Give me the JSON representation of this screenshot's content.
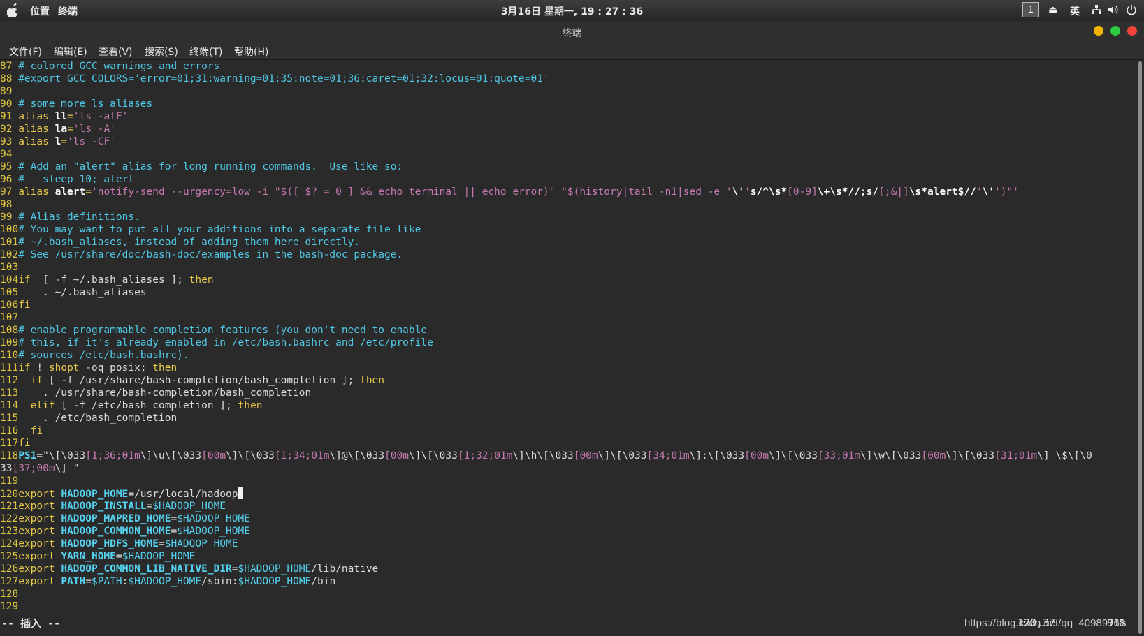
{
  "topbar": {
    "places": "位置",
    "app": "终端",
    "clock": "3月16日 星期一, 19 : 27 : 36",
    "workspace": "1",
    "input_method": "英"
  },
  "window": {
    "title": "终端"
  },
  "menu": [
    "文件(F)",
    "编辑(E)",
    "查看(V)",
    "搜索(S)",
    "终端(T)",
    "帮助(H)"
  ],
  "status": {
    "mode": "-- 插入 --",
    "position": "120,37",
    "percent": "91%"
  },
  "watermark": "https://blog.csdn.net/qq_40989768",
  "lines": [
    {
      "n": "87",
      "parts": [
        [
          "c",
          "# colored GCC warnings and errors"
        ]
      ]
    },
    {
      "n": "88",
      "parts": [
        [
          "c",
          "#export GCC_COLORS='error=01;31:warning=01;35:note=01;36:caret=01;32:locus=01:quote=01'"
        ]
      ]
    },
    {
      "n": "89",
      "parts": []
    },
    {
      "n": "90",
      "parts": [
        [
          "c",
          "# some more ls aliases"
        ]
      ]
    },
    {
      "n": "91",
      "parts": [
        [
          "k",
          "alias "
        ],
        [
          "wb",
          "ll"
        ],
        [
          "k",
          "="
        ],
        [
          "s",
          "'ls -alF'"
        ]
      ]
    },
    {
      "n": "92",
      "parts": [
        [
          "k",
          "alias "
        ],
        [
          "wb",
          "la"
        ],
        [
          "k",
          "="
        ],
        [
          "s",
          "'ls -A'"
        ]
      ]
    },
    {
      "n": "93",
      "parts": [
        [
          "k",
          "alias "
        ],
        [
          "wb",
          "l"
        ],
        [
          "k",
          "="
        ],
        [
          "s",
          "'ls -CF'"
        ]
      ]
    },
    {
      "n": "94",
      "parts": []
    },
    {
      "n": "95",
      "parts": [
        [
          "c",
          "# Add an \"alert\" alias for long running commands.  Use like so:"
        ]
      ]
    },
    {
      "n": "96",
      "parts": [
        [
          "c",
          "#   sleep 10; alert"
        ]
      ]
    },
    {
      "n": "97",
      "parts": [
        [
          "k",
          "alias "
        ],
        [
          "wb",
          "alert"
        ],
        [
          "k",
          "="
        ],
        [
          "s",
          "'notify-send --urgency=low -i \"$([ $? = 0 ] && echo terminal || echo error)\" \"$(history|tail -n1|sed -e '"
        ],
        [
          "wb",
          "\\'"
        ],
        [
          "s",
          "'"
        ],
        [
          "wb",
          "s/^\\s*"
        ],
        [
          "s",
          "[0-9]"
        ],
        [
          "wb",
          "\\+\\s*//;s/"
        ],
        [
          "s",
          "[;&|]"
        ],
        [
          "wb",
          "\\s*alert$//"
        ],
        [
          "s",
          "'"
        ],
        [
          "wb",
          "\\'"
        ],
        [
          "s",
          "')\"'"
        ]
      ]
    },
    {
      "n": "98",
      "parts": []
    },
    {
      "n": "99",
      "parts": [
        [
          "c",
          "# Alias definitions."
        ]
      ]
    },
    {
      "n": "100",
      "parts": [
        [
          "c",
          "# You may want to put all your additions into a separate file like"
        ]
      ]
    },
    {
      "n": "101",
      "parts": [
        [
          "c",
          "# ~/.bash_aliases, instead of adding them here directly."
        ]
      ]
    },
    {
      "n": "102",
      "parts": [
        [
          "c",
          "# See /usr/share/doc/bash-doc/examples in the bash-doc package."
        ]
      ]
    },
    {
      "n": "103",
      "parts": []
    },
    {
      "n": "104",
      "parts": [
        [
          "k",
          "if"
        ],
        [
          "",
          "  [ -f ~/.bash_aliases ]; "
        ],
        [
          "k",
          "then"
        ]
      ]
    },
    {
      "n": "105",
      "parts": [
        [
          "",
          "    . ~/.bash_aliases"
        ]
      ]
    },
    {
      "n": "106",
      "parts": [
        [
          "k",
          "fi"
        ]
      ]
    },
    {
      "n": "107",
      "parts": []
    },
    {
      "n": "108",
      "parts": [
        [
          "c",
          "# enable programmable completion features (you don't need to enable"
        ]
      ]
    },
    {
      "n": "109",
      "parts": [
        [
          "c",
          "# this, if it's already enabled in /etc/bash.bashrc and /etc/profile"
        ]
      ]
    },
    {
      "n": "110",
      "parts": [
        [
          "c",
          "# sources /etc/bash.bashrc)."
        ]
      ]
    },
    {
      "n": "111",
      "parts": [
        [
          "k",
          "if"
        ],
        [
          "",
          " ! "
        ],
        [
          "k",
          "shopt"
        ],
        [
          "",
          " -oq posix; "
        ],
        [
          "k",
          "then"
        ]
      ]
    },
    {
      "n": "112",
      "parts": [
        [
          "",
          "  "
        ],
        [
          "k",
          "if"
        ],
        [
          "",
          " [ -f /usr/share/bash-completion/bash_completion ]; "
        ],
        [
          "k",
          "then"
        ]
      ]
    },
    {
      "n": "113",
      "parts": [
        [
          "",
          "    . /usr/share/bash-completion/bash_completion"
        ]
      ]
    },
    {
      "n": "114",
      "parts": [
        [
          "",
          "  "
        ],
        [
          "k",
          "elif"
        ],
        [
          "",
          " [ -f /etc/bash_completion ]; "
        ],
        [
          "k",
          "then"
        ]
      ]
    },
    {
      "n": "115",
      "parts": [
        [
          "",
          "    . /etc/bash_completion"
        ]
      ]
    },
    {
      "n": "116",
      "parts": [
        [
          "",
          "  "
        ],
        [
          "k",
          "fi"
        ]
      ]
    },
    {
      "n": "117",
      "parts": [
        [
          "k",
          "fi"
        ]
      ]
    },
    {
      "n": "118",
      "parts": [
        [
          "b",
          "PS1"
        ],
        [
          "",
          "=\"\\[\\033"
        ],
        [
          "s",
          "[1;36;01m"
        ],
        [
          "",
          "\\]\\u\\[\\033"
        ],
        [
          "s",
          "[00m"
        ],
        [
          "",
          "\\]\\[\\033"
        ],
        [
          "s",
          "[1;34;01m"
        ],
        [
          "",
          "\\]@\\[\\033"
        ],
        [
          "s",
          "[00m"
        ],
        [
          "",
          "\\]\\[\\033"
        ],
        [
          "s",
          "[1;32;01m"
        ],
        [
          "",
          "\\]\\h\\[\\033"
        ],
        [
          "s",
          "[00m"
        ],
        [
          "",
          "\\]\\[\\033"
        ],
        [
          "s",
          "[34;01m"
        ],
        [
          "",
          "\\]:\\[\\033"
        ],
        [
          "s",
          "[00m"
        ],
        [
          "",
          "\\]\\[\\033"
        ],
        [
          "s",
          "[33;01m"
        ],
        [
          "",
          "\\]\\w\\[\\033"
        ],
        [
          "s",
          "[00m"
        ],
        [
          "",
          "\\]\\[\\033"
        ],
        [
          "s",
          "[31;01m"
        ],
        [
          "",
          "\\] \\$\\[\\0"
        ]
      ]
    },
    {
      "n": "",
      "parts": [
        [
          "",
          "33"
        ],
        [
          "s",
          "[37;00m"
        ],
        [
          "",
          "\\] \""
        ]
      ]
    },
    {
      "n": "119",
      "parts": []
    },
    {
      "n": "120",
      "parts": [
        [
          "k",
          "export "
        ],
        [
          "b",
          "HADOOP_HOME"
        ],
        [
          "",
          "=/usr/local/hadoop"
        ]
      ],
      "cursor": true
    },
    {
      "n": "121",
      "parts": [
        [
          "k",
          "export "
        ],
        [
          "b",
          "HADOOP_INSTALL"
        ],
        [
          "",
          "="
        ],
        [
          "v",
          "$HADOOP_HOME"
        ]
      ]
    },
    {
      "n": "122",
      "parts": [
        [
          "k",
          "export "
        ],
        [
          "b",
          "HADOOP_MAPRED_HOME"
        ],
        [
          "",
          "="
        ],
        [
          "v",
          "$HADOOP_HOME"
        ]
      ]
    },
    {
      "n": "123",
      "parts": [
        [
          "k",
          "export "
        ],
        [
          "b",
          "HADOOP_COMMON_HOME"
        ],
        [
          "",
          "="
        ],
        [
          "v",
          "$HADOOP_HOME"
        ]
      ]
    },
    {
      "n": "124",
      "parts": [
        [
          "k",
          "export "
        ],
        [
          "b",
          "HADOOP_HDFS_HOME"
        ],
        [
          "",
          "="
        ],
        [
          "v",
          "$HADOOP_HOME"
        ]
      ]
    },
    {
      "n": "125",
      "parts": [
        [
          "k",
          "export "
        ],
        [
          "b",
          "YARN_HOME"
        ],
        [
          "",
          "="
        ],
        [
          "v",
          "$HADOOP_HOME"
        ]
      ]
    },
    {
      "n": "126",
      "parts": [
        [
          "k",
          "export "
        ],
        [
          "b",
          "HADOOP_COMMON_LIB_NATIVE_DIR"
        ],
        [
          "",
          "="
        ],
        [
          "v",
          "$HADOOP_HOME"
        ],
        [
          "",
          "/lib/native"
        ]
      ]
    },
    {
      "n": "127",
      "parts": [
        [
          "k",
          "export "
        ],
        [
          "b",
          "PATH"
        ],
        [
          "",
          "="
        ],
        [
          "v",
          "$PATH"
        ],
        [
          "",
          ":"
        ],
        [
          "v",
          "$HADOOP_HOME"
        ],
        [
          "",
          "/sbin:"
        ],
        [
          "v",
          "$HADOOP_HOME"
        ],
        [
          "",
          "/bin"
        ]
      ]
    },
    {
      "n": "128",
      "parts": []
    },
    {
      "n": "129",
      "parts": []
    }
  ]
}
